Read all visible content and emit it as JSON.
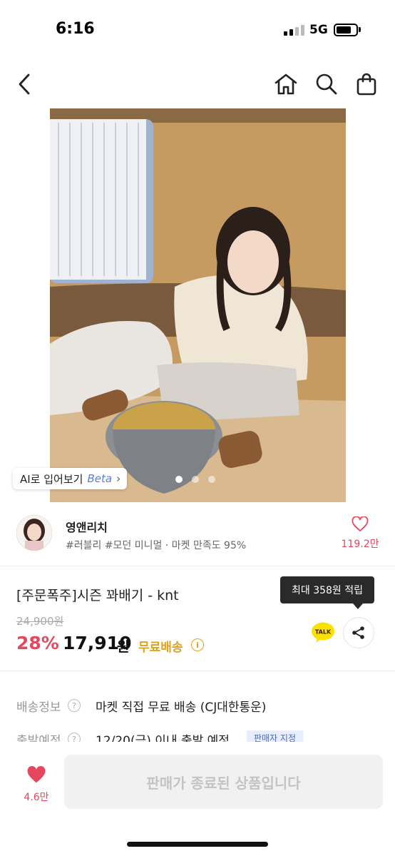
{
  "status_bar": {
    "time": "6:16",
    "network": "5G"
  },
  "nav": {
    "back_icon": "chevron-left-icon",
    "home_icon": "home-icon",
    "search_icon": "search-icon",
    "cart_icon": "shopping-bag-icon"
  },
  "gallery": {
    "ai_tryon_label": "AI로 입어보기",
    "ai_tryon_beta": "Beta",
    "ai_tryon_chevron": "›",
    "image_count": 3,
    "active_index": 0
  },
  "store": {
    "name": "영앤리치",
    "tags": "#러블리 #모던 미니멀 · 마켓 만족도 95%",
    "like_count": "119.2만"
  },
  "product": {
    "name": "[주문폭주]시즌 꽈배기 - knt",
    "original_price": "24,900원",
    "discount": "28%",
    "price": "17,910",
    "price_unit": "원",
    "free_shipping": "무료배송",
    "info_glyph": "i",
    "tooltip": "최대 358원 적립",
    "talk_label": "TALK"
  },
  "delivery": [
    {
      "label": "배송정보",
      "help": "?",
      "value": "마켓 직접 무료 배송 (CJ대한통운)",
      "badge": ""
    },
    {
      "label": "출발예정",
      "help": "?",
      "value": "12/20(금) 이내 출발 예정",
      "badge": "판매자 지정"
    }
  ],
  "bottom": {
    "wish_count": "4.6만",
    "buy_label": "판매가 종료된 상품입니다"
  },
  "colors": {
    "accent_pink": "#e8465d",
    "free_ship_gold": "#e0a21c",
    "tooltip_bg": "#2a2a2a",
    "talk_yellow": "#fae100"
  }
}
